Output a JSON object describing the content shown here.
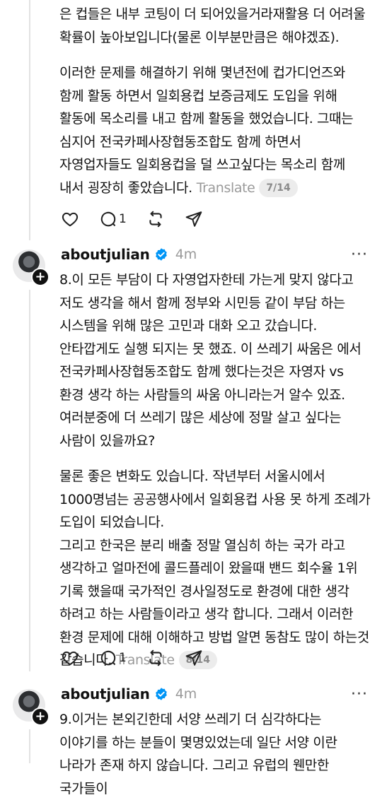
{
  "post1": {
    "paragraphs": [
      "은 컵들은 내부 코팅이 더 되어있을거라재활용 더 어려울 확률이 높아보입니다(물론 이부분만큼은 해야겠죠).",
      "이러한 문제를 해결하기 위해 몇년전에 컵가디언즈와 함께 활동 하면서 일회용컵 보증금제도 도입을 위해 활동에 목소리를 내고 함께 활동을 했었습니다. 그때는 심지어 전국카페사장협동조합도 함께 하면서 자영업자들도 일회용컵을 덜 쓰고싶다는 목소리 함께 내서 굉장히 좋았습니다."
    ],
    "translate_label": "Translate",
    "page_indicator": "7/14",
    "reply_count": "1"
  },
  "post2": {
    "username": "aboutjulian",
    "time": "4m",
    "paragraphs": [
      "8.이 모든 부담이 다 자영업자한테 가는게 맞지 않다고 저도 생각을 해서 함께 정부와 시민등 같이 부담 하는 시스템을 위해 많은 고민과 대화 오고 갔습니다. 안타깝게도 실행 되지는 못 했죠. 이 쓰레기 싸움은 에서 전국카페사장협동조합도 함께 했다는것은 자영자 vs 환경 생각 하는 사람들의 싸움 아니라는거 알수 있죠. 여러분중에 더 쓰레기 많은 세상에 정말 살고 싶다는 사람이 있을까요?",
      "물론 좋은 변화도 있습니다. 작년부터 서울시에서 1000명넘는 공공행사에서 일회용컵 사용 못 하게 조례가 도입이 되었습니다.",
      "그리고 한국은 분리 배출 정말 열심히 하는 국가 라고 생각하고 얼마전에 콜드플레이 왔을때 밴드 회수율 1위 기록 했을때 국가적인 경사일정도로 환경에 대한 생각 하려고 하는 사람들이라고 생각 합니다. 그래서 이러한 환경 문제에 대해 이해하고 방법 알면 동참도 많이 하는것 같습니다."
    ],
    "translate_label": "Translate",
    "page_indicator": "8/14",
    "reply_count": "1"
  },
  "post3": {
    "username": "aboutjulian",
    "time": "4m",
    "paragraphs": [
      "9.이거는 본외긴한데 서양 쓰레기 더 심각하다는 이야기를 하는 분들이 몇명있었는데 일단 서양 이란 나라가 존재 하지 않습니다. 그리고 유럽의 웬만한 국가들이"
    ]
  },
  "colors": {
    "verified": "#0095f6",
    "muted": "#9a9a9a"
  }
}
